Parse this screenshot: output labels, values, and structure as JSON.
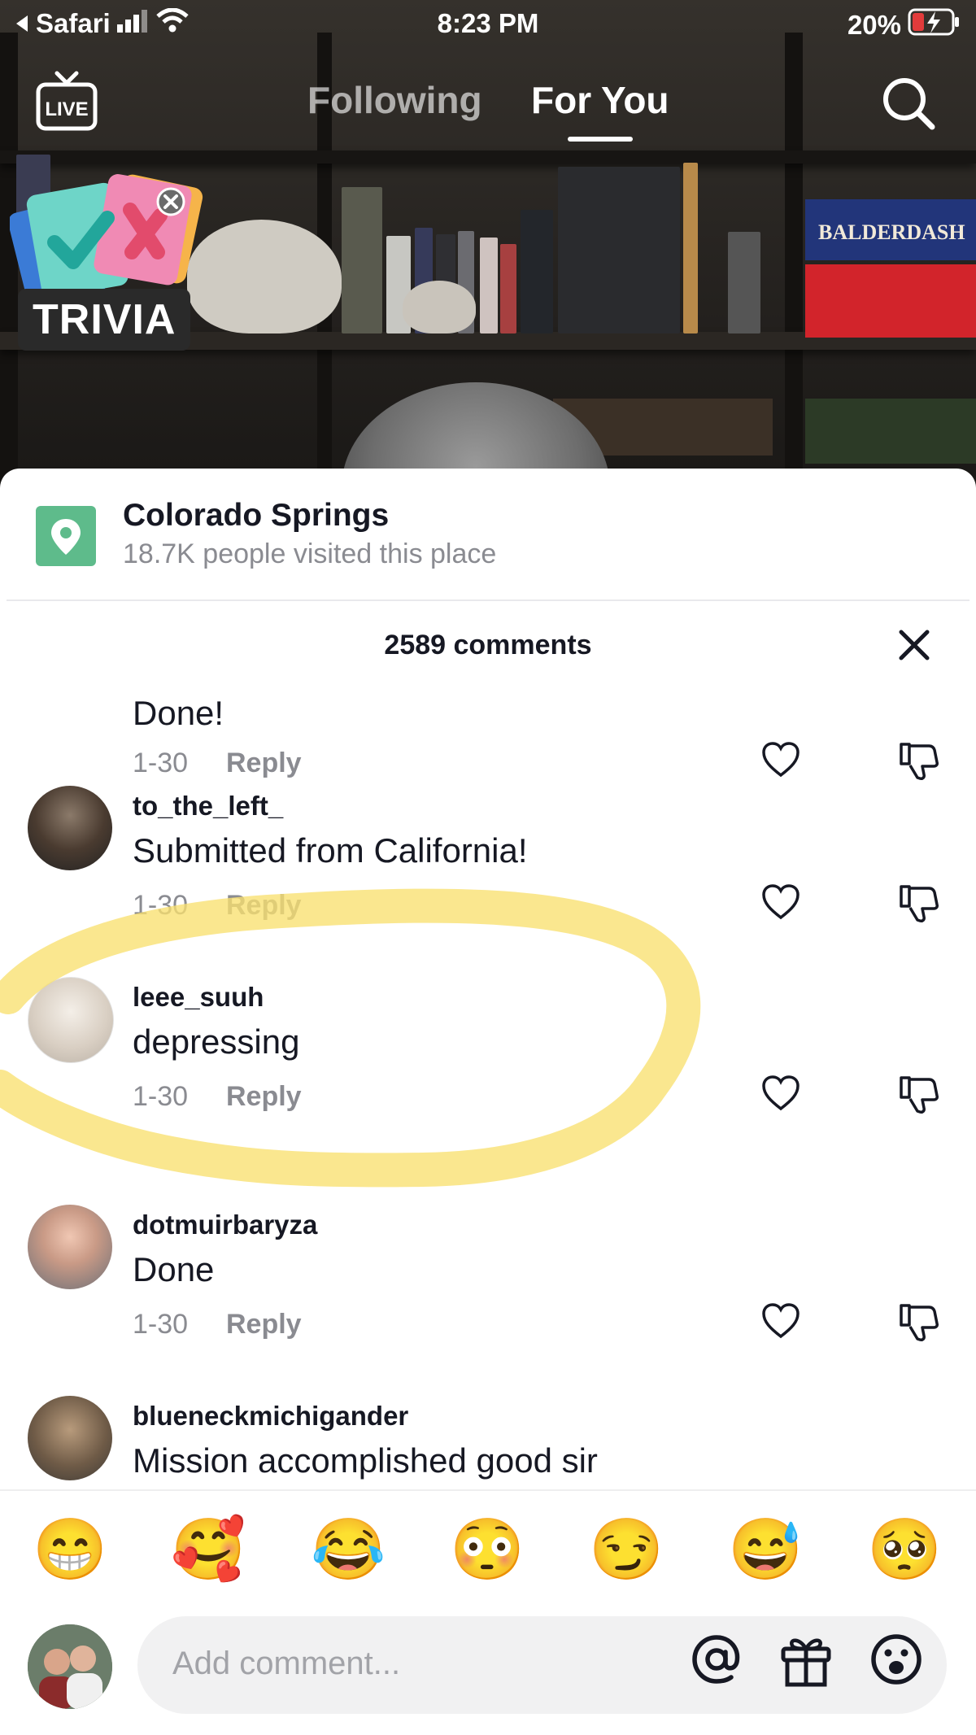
{
  "status_bar": {
    "back_app": "Safari",
    "time": "8:23 PM",
    "battery": "20%"
  },
  "top_nav": {
    "live_label": "LIVE",
    "tabs": [
      "Following",
      "For You"
    ],
    "active_tab": "For You"
  },
  "video": {
    "sticker_label": "TRIVIA",
    "game_box_label": "BALDERDASH"
  },
  "location": {
    "name": "Colorado Springs",
    "subtitle": "18.7K people visited this place",
    "icon": "location-pin-icon",
    "color": "#5ebb8b"
  },
  "comments_header": {
    "count_label": "2589 comments"
  },
  "comments": [
    {
      "username": "",
      "text": "Done!",
      "date": "1-30",
      "reply": "Reply"
    },
    {
      "username": "to_the_left_",
      "text": "Submitted from California!",
      "date": "1-30",
      "reply": "Reply",
      "highlighted": true
    },
    {
      "username": "leee_suuh",
      "text": "depressing",
      "date": "1-30",
      "reply": "Reply"
    },
    {
      "username": "dotmuirbaryza",
      "text": "Done",
      "date": "1-30",
      "reply": "Reply"
    },
    {
      "username": "blueneckmichigander",
      "text": "Mission accomplished good sir",
      "date": "",
      "reply": ""
    }
  ],
  "emoji_bar": [
    "😁",
    "🥰",
    "😂",
    "😳",
    "😏",
    "😅",
    "🥺"
  ],
  "input": {
    "placeholder": "Add comment...",
    "icons": [
      "at-mention-icon",
      "gift-icon",
      "emoji-picker-icon"
    ]
  },
  "colors": {
    "highlight": "#f8e070",
    "muted_text": "#8a8b91"
  }
}
